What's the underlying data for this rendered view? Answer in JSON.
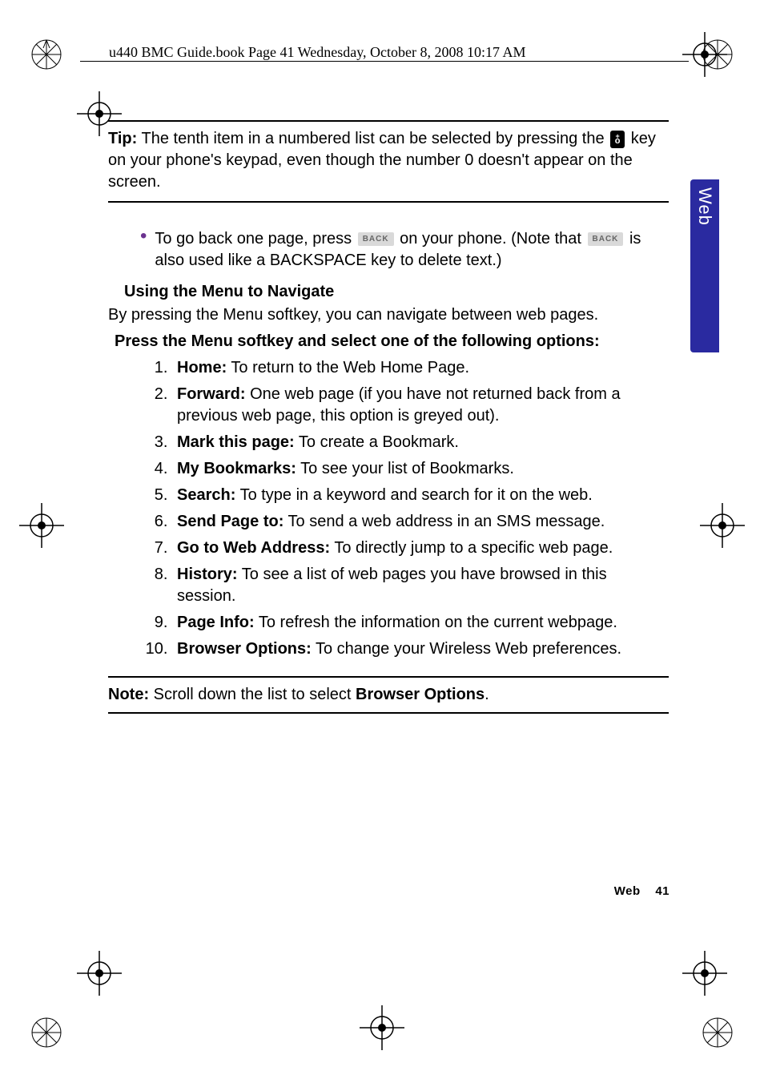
{
  "header": "u440 BMC Guide.book  Page 41  Wednesday, October 8, 2008  10:17 AM",
  "sideTab": "Web",
  "tip": {
    "label": "Tip:",
    "part1": " The tenth item in a numbered list can be selected by pressing the ",
    "part2": " key on your phone's keypad, even though the number 0 doesn't appear on the screen."
  },
  "bullet": {
    "pre": "To go back one page, press ",
    "mid": " on your phone. (Note that ",
    "post": " is also used like a BACKSPACE key to delete text.)",
    "keyLabel": "BACK"
  },
  "subhead": "Using the Menu to Navigate",
  "bodyText": "By pressing the Menu softkey, you can navigate between web pages.",
  "instruction": "Press the Menu softkey and select one of the following options:",
  "menuItems": [
    {
      "label": "Home:",
      "desc": " To return to the Web Home Page."
    },
    {
      "label": "Forward:",
      "desc": " One web page (if you have not returned back from a previous web page, this option is greyed out)."
    },
    {
      "label": "Mark this page:",
      "desc": " To create a Bookmark."
    },
    {
      "label": "My Bookmarks:",
      "desc": " To see your list of Bookmarks."
    },
    {
      "label": "Search:",
      "desc": " To type in a keyword and search for it on the web."
    },
    {
      "label": "Send Page to:",
      "desc": " To send a web address in an SMS message."
    },
    {
      "label": "Go to Web Address:",
      "desc": " To directly jump to a specific web page."
    },
    {
      "label": "History:",
      "desc": " To see a list of web pages you have browsed in this session."
    },
    {
      "label": "Page Info:",
      "desc": " To refresh the information on the current webpage."
    },
    {
      "label": "Browser Options:",
      "desc": " To change your Wireless Web preferences."
    }
  ],
  "note": {
    "label": "Note:",
    "pre": " Scroll down the list to select ",
    "strong": "Browser Options",
    "post": "."
  },
  "footer": {
    "section": "Web",
    "page": "41"
  }
}
